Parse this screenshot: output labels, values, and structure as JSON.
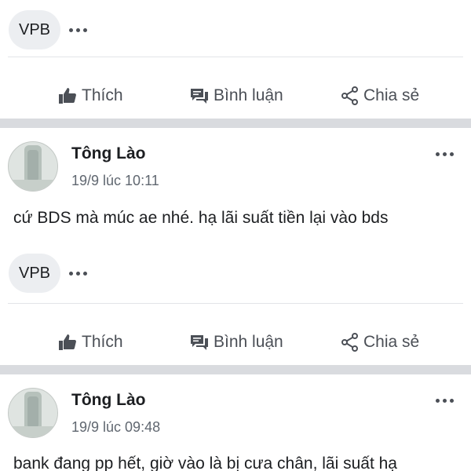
{
  "posts": [
    {
      "tag": "VPB",
      "actions": {
        "like": "Thích",
        "comment": "Bình luận",
        "share": "Chia sẻ"
      }
    },
    {
      "author": "Tông Lào",
      "time": "19/9 lúc 10:11",
      "text": "cứ BDS mà múc ae nhé. hạ lãi suất tiền lại vào bds",
      "tag": "VPB",
      "actions": {
        "like": "Thích",
        "comment": "Bình luận",
        "share": "Chia sẻ"
      }
    },
    {
      "author": "Tông Lào",
      "time": "19/9 lúc 09:48",
      "text": "bank đang pp hết, giờ vào là bị cưa chân, lãi suất hạ"
    }
  ],
  "colors": {
    "action_text": "#4b4f56",
    "chip_bg": "#eceef1",
    "separator": "#d9dbdf"
  },
  "icons": [
    "like-icon",
    "comment-icon",
    "share-icon",
    "more-icon",
    "avatar"
  ]
}
